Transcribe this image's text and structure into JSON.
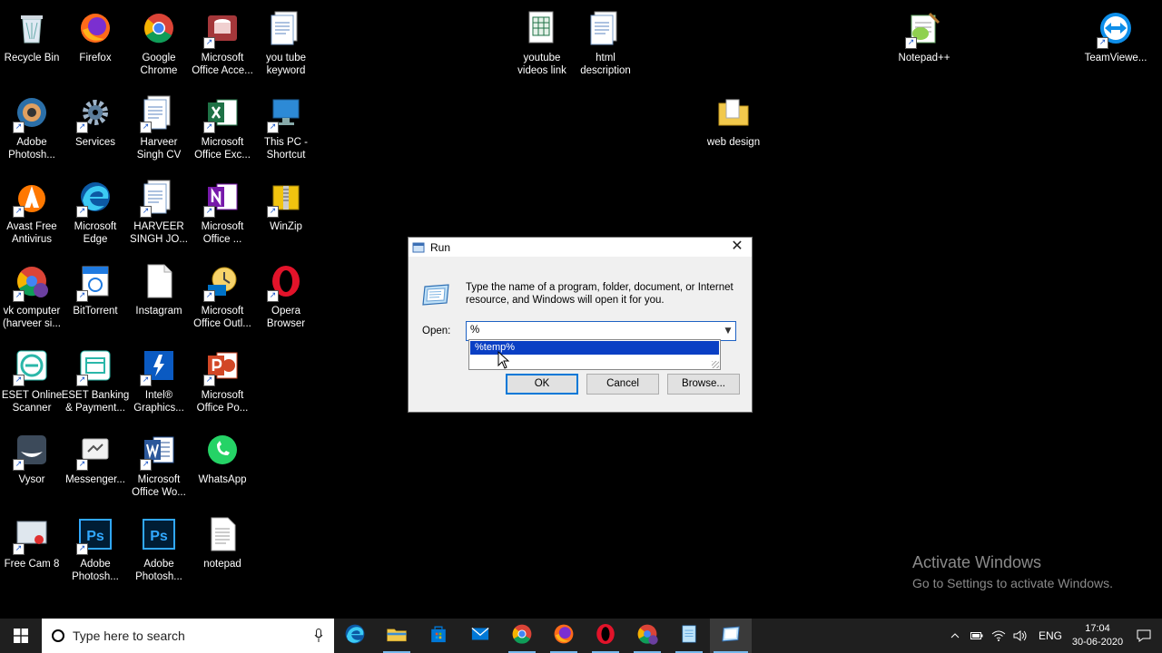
{
  "desktop_icons": [
    {
      "label": "Recycle Bin",
      "icon": "recycle-bin-icon"
    },
    {
      "label": "Firefox",
      "icon": "firefox-icon"
    },
    {
      "label": "Google\nChrome",
      "icon": "chrome-icon"
    },
    {
      "label": "Microsoft\nOffice Acce...",
      "icon": "access-icon"
    },
    {
      "label": "you tube\nkeyword",
      "icon": "document-icon"
    },
    {
      "label": "Adobe\nPhotosh...",
      "icon": "photoshop-app-icon"
    },
    {
      "label": "Services",
      "icon": "gear-icon"
    },
    {
      "label": "Harveer\nSingh CV",
      "icon": "document-icon"
    },
    {
      "label": "Microsoft\nOffice Exc...",
      "icon": "excel-icon"
    },
    {
      "label": "This PC -\nShortcut",
      "icon": "this-pc-icon"
    },
    {
      "label": "Avast Free\nAntivirus",
      "icon": "avast-icon"
    },
    {
      "label": "Microsoft\nEdge",
      "icon": "edge-icon"
    },
    {
      "label": "HARVEER\nSINGH JO...",
      "icon": "document-icon"
    },
    {
      "label": "Microsoft\nOffice ...",
      "icon": "onenote-icon"
    },
    {
      "label": "WinZip",
      "icon": "winzip-icon"
    },
    {
      "label": "vk computer\n(harveer si...",
      "icon": "chrome-profile-icon"
    },
    {
      "label": "BitTorrent",
      "icon": "bittorrent-icon"
    },
    {
      "label": "Instagram",
      "icon": "blank-file-icon"
    },
    {
      "label": "Microsoft\nOffice Outl...",
      "icon": "outlook-icon"
    },
    {
      "label": "Opera\nBrowser",
      "icon": "opera-icon"
    },
    {
      "label": "ESET Online\nScanner",
      "icon": "eset-icon"
    },
    {
      "label": "ESET Banking\n& Payment...",
      "icon": "eset-banking-icon"
    },
    {
      "label": "Intel®\nGraphics...",
      "icon": "intel-icon"
    },
    {
      "label": "Microsoft\nOffice Po...",
      "icon": "powerpoint-icon"
    },
    {
      "label": "Vysor",
      "icon": "vysor-icon"
    },
    {
      "label": "Messenger...",
      "icon": "messenger-icon"
    },
    {
      "label": "Microsoft\nOffice Wo...",
      "icon": "word-icon"
    },
    {
      "label": "WhatsApp",
      "icon": "whatsapp-icon"
    },
    {
      "label": "Free Cam 8",
      "icon": "freecam-icon"
    },
    {
      "label": "Adobe\nPhotosh...",
      "icon": "photoshop-icon"
    },
    {
      "label": "Adobe\nPhotosh...",
      "icon": "photoshop-icon"
    },
    {
      "label": "notepad",
      "icon": "text-file-icon"
    },
    {
      "label": "youtube\nvideos link",
      "icon": "excel-file-icon"
    },
    {
      "label": "html\ndescription",
      "icon": "document-icon"
    },
    {
      "label": "web design",
      "icon": "folder-icon"
    },
    {
      "label": "Notepad++",
      "icon": "notepadpp-icon"
    },
    {
      "label": "TeamViewe...",
      "icon": "teamviewer-icon"
    }
  ],
  "watermark": {
    "line1": "Activate Windows",
    "line2": "Go to Settings to activate Windows."
  },
  "run_dialog": {
    "title": "Run",
    "description": "Type the name of a program, folder, document, or Internet resource, and Windows will open it for you.",
    "open_label": "Open:",
    "input_value": "%",
    "autocomplete_item": "%temp%",
    "ok_label": "OK",
    "cancel_label": "Cancel",
    "browse_label": "Browse..."
  },
  "taskbar": {
    "search_placeholder": "Type here to search",
    "apps": [
      "edge-icon",
      "file-explorer-icon",
      "store-icon",
      "mail-icon",
      "chrome-icon",
      "firefox-icon",
      "opera-icon",
      "chrome-profile-icon",
      "notepad-icon",
      "run-icon"
    ],
    "language": "ENG",
    "time": "17:04",
    "date": "30-06-2020"
  },
  "colors": {
    "selection": "#0a3fc4",
    "focus": "#0078d7",
    "taskbar": "#1f1f1f"
  }
}
